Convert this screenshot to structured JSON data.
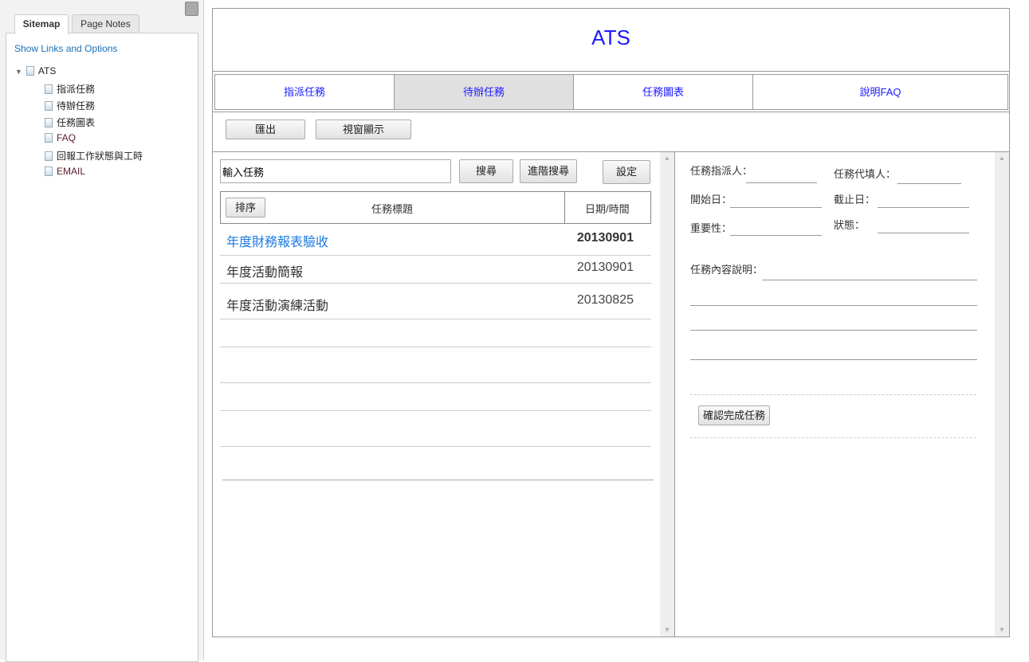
{
  "sitemap": {
    "tabs": [
      {
        "label": "Sitemap",
        "active": true
      },
      {
        "label": "Page Notes",
        "active": false
      }
    ],
    "options_link": "Show Links and Options",
    "root": "ATS",
    "pages": [
      "指派任務",
      "待辦任務",
      "任務圖表",
      "FAQ",
      "回報工作狀態與工時",
      "EMAIL"
    ]
  },
  "header": {
    "title": "ATS",
    "title_color": "#1a1aff"
  },
  "nav": {
    "items": [
      {
        "label": "指派任務"
      },
      {
        "label": "待辦任務",
        "active": true
      },
      {
        "label": "任務圖表"
      },
      {
        "label": "說明FAQ"
      }
    ]
  },
  "toolbar": {
    "export": "匯出",
    "window_view": "視窗顯示"
  },
  "search": {
    "value": "輸入任務",
    "search": "搜尋",
    "advanced": "進階搜尋",
    "settings": "設定"
  },
  "table": {
    "sort": "排序",
    "col_title": "任務標題",
    "col_date": "日期/時間",
    "rows": [
      {
        "title": "年度財務報表驗收",
        "date": "20130901",
        "selected": true
      },
      {
        "title": "年度活動簡報",
        "date": "20130901"
      },
      {
        "title": "年度活動演練活動",
        "date": "20130825"
      }
    ]
  },
  "detail": {
    "assigner": "任務指派人：",
    "proxy": "任務代填人：",
    "start": "開始日：",
    "due": "截止日：",
    "importance": "重要性：",
    "status": "狀態：",
    "description": "任務內容說明：",
    "confirm": "確認完成任務"
  }
}
